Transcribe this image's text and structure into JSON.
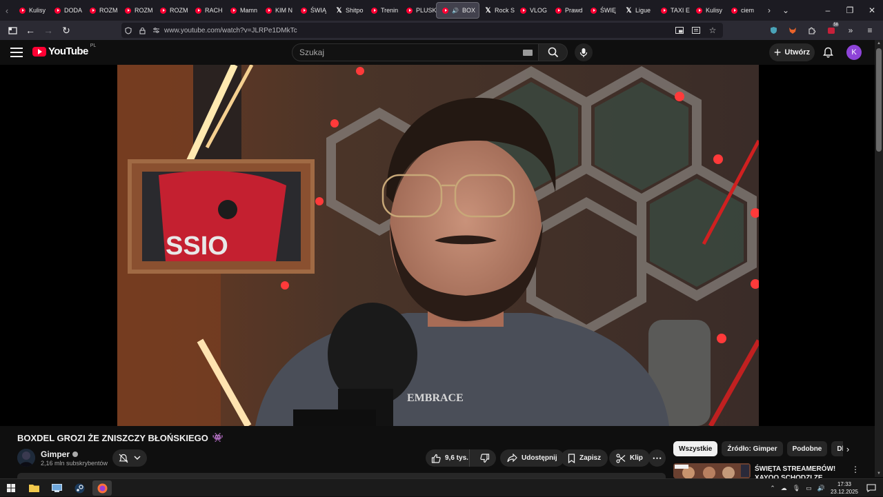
{
  "browser": {
    "tabs": [
      {
        "label": "Kulisy",
        "icon": "youtube-icon"
      },
      {
        "label": "DODA",
        "icon": "youtube-icon"
      },
      {
        "label": "ROZM",
        "icon": "youtube-icon"
      },
      {
        "label": "ROZM",
        "icon": "youtube-icon"
      },
      {
        "label": "ROZM",
        "icon": "youtube-icon"
      },
      {
        "label": "RACH",
        "icon": "youtube-icon"
      },
      {
        "label": "Mamn",
        "icon": "youtube-icon"
      },
      {
        "label": "KIM N",
        "icon": "youtube-icon"
      },
      {
        "label": "ŚWIĄ",
        "icon": "youtube-icon"
      },
      {
        "label": "Shitpo",
        "icon": "x-icon"
      },
      {
        "label": "Trenin",
        "icon": "youtube-icon"
      },
      {
        "label": "PLUSK",
        "icon": "youtube-icon"
      },
      {
        "label": "BOX",
        "icon": "youtube-icon",
        "active": true
      },
      {
        "label": "Rock S",
        "icon": "x-icon"
      },
      {
        "label": "VLOG",
        "icon": "youtube-icon"
      },
      {
        "label": "Prawd",
        "icon": "youtube-icon"
      },
      {
        "label": "ŚWIĘ",
        "icon": "youtube-icon"
      },
      {
        "label": "Ligue",
        "icon": "x-icon"
      },
      {
        "label": "TAXI E",
        "icon": "youtube-icon"
      },
      {
        "label": "Kulisy",
        "icon": "youtube-icon"
      },
      {
        "label": "ciem",
        "icon": "youtube-icon"
      }
    ],
    "url": "www.youtube.com/watch?v=JLRPe1DMkTc",
    "extension_badge": "58"
  },
  "youtube": {
    "logo_text": "YouTube",
    "country_code": "PL",
    "search_placeholder": "Szukaj",
    "create_label": "Utwórz",
    "avatar_letter": "K",
    "avatar_color": "#8e44d8"
  },
  "video": {
    "title": "BOXDEL GROZI ŻE ZNISZCZY BŁOŃSKIEGO",
    "title_emoji": "👾",
    "channel_name": "Gimper",
    "subscribers": "2,16 mln subskrybentów",
    "likes": "9,6 tys.",
    "share_label": "Udostępnij",
    "save_label": "Zapisz",
    "clip_label": "Klip"
  },
  "sidebar": {
    "chips": [
      {
        "label": "Wszystkie",
        "active": true
      },
      {
        "label": "Źródło: Gimper"
      },
      {
        "label": "Podobne"
      },
      {
        "label": "Dla C"
      }
    ],
    "recommendation_title": "ŚWIĘTA STREAMERÓW! XAYOO SCHODZI ZE SCENY!?"
  },
  "taskbar": {
    "time": "17:33",
    "date": "23.12.2025"
  }
}
